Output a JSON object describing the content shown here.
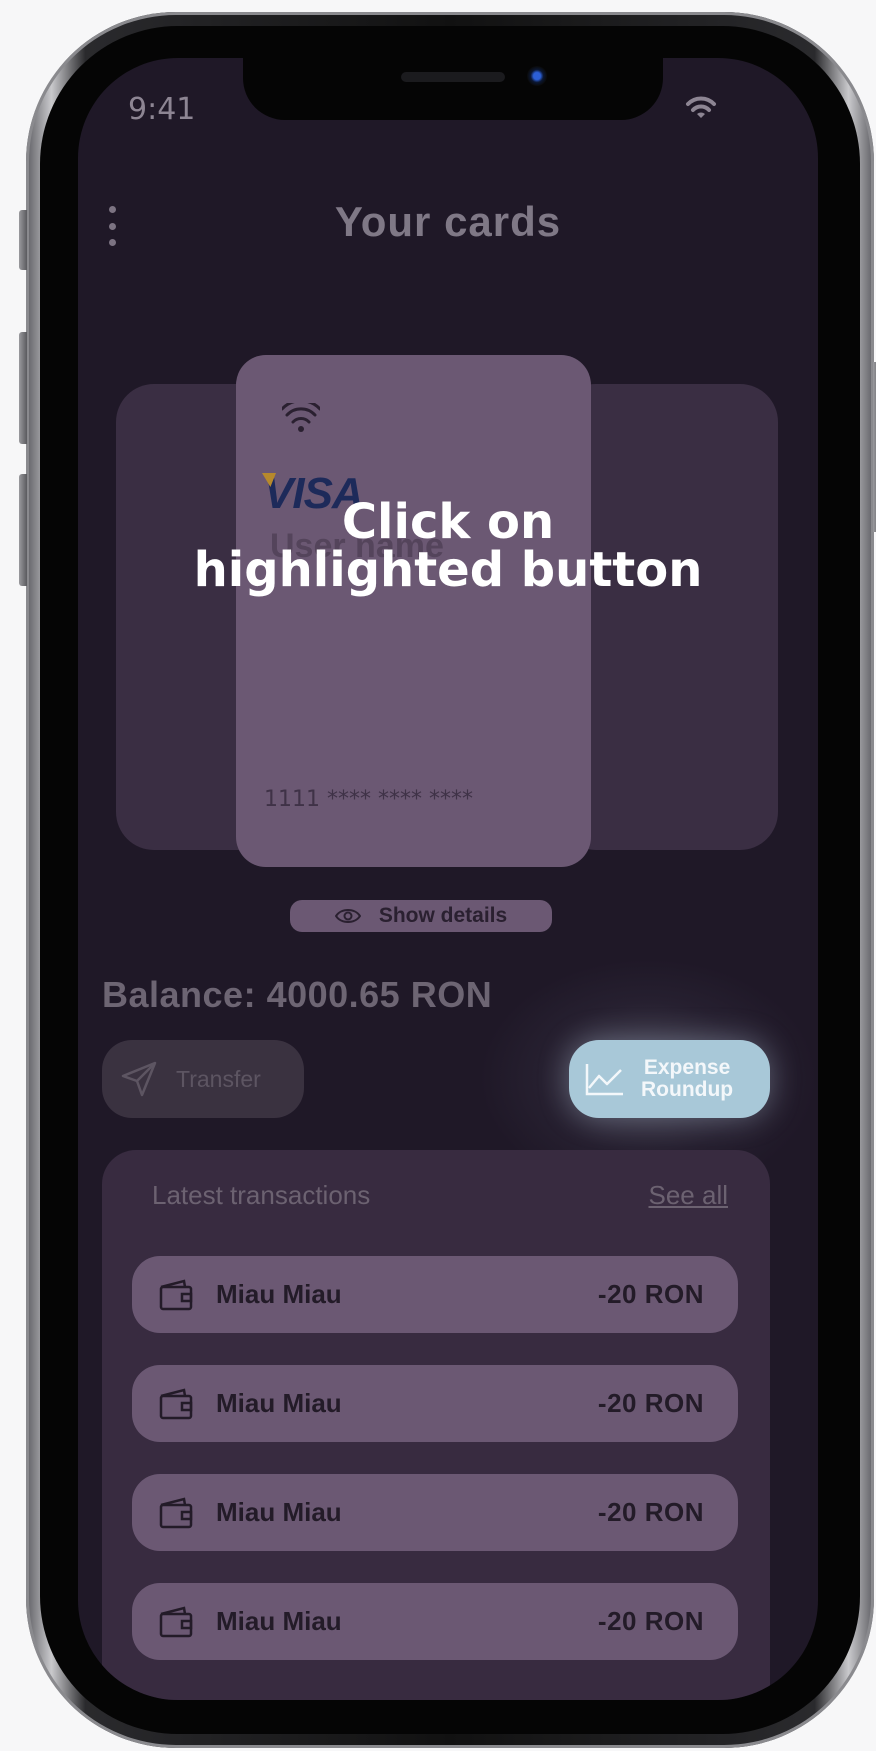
{
  "status": {
    "time": "9:41"
  },
  "header": {
    "title": "Your cards"
  },
  "card": {
    "brand": "VISA",
    "holder": "User name",
    "number": "1111 **** **** ****"
  },
  "actions": {
    "show_details": "Show details",
    "transfer": "Transfer",
    "expense_line1": "Expense",
    "expense_line2": "Roundup"
  },
  "balance": "Balance: 4000.65 RON",
  "transactions": {
    "title": "Latest transactions",
    "see_all": "See all",
    "items": [
      {
        "name": "Miau Miau",
        "amount": "-20 RON"
      },
      {
        "name": "Miau Miau",
        "amount": "-20 RON"
      },
      {
        "name": "Miau Miau",
        "amount": "-20 RON"
      },
      {
        "name": "Miau Miau",
        "amount": "-20 RON"
      }
    ]
  },
  "overlay": {
    "line1": "Click on",
    "line2": "highlighted button"
  },
  "icons": [
    "menu-dots-icon",
    "wifi-icon",
    "contactless-icon",
    "eye-icon",
    "send-icon",
    "chart-line-icon",
    "wallet-icon"
  ],
  "colors": {
    "background": "#1f1827",
    "card": "#6b5873",
    "highlight": "#a8c8d8"
  }
}
